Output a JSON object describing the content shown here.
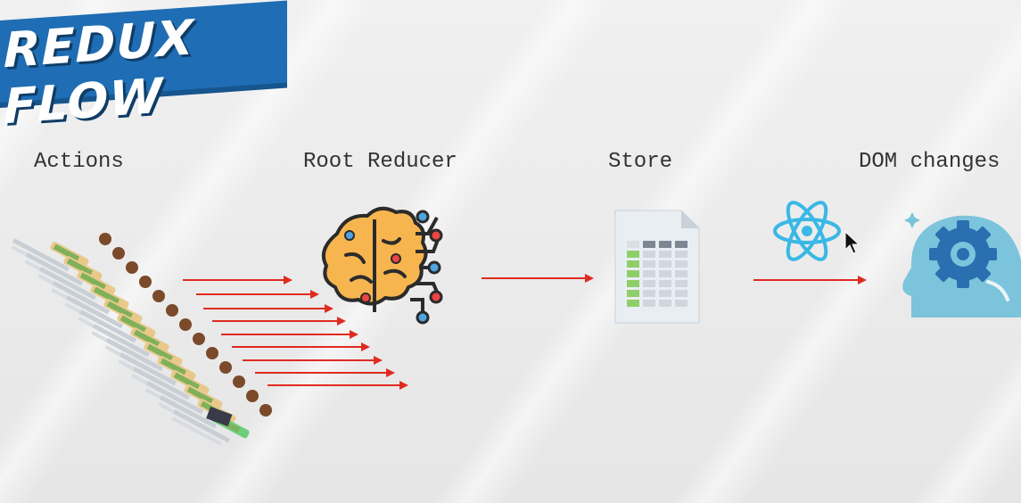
{
  "title": "REDUX FLOW",
  "stages": [
    {
      "label": "Actions"
    },
    {
      "label": "Root Reducer"
    },
    {
      "label": "Store"
    },
    {
      "label": "DOM changes"
    }
  ],
  "icons": {
    "actions": "crowd-running-icon",
    "reducer": "brain-circuit-icon",
    "store": "spreadsheet-document-icon",
    "react": "react-logo-icon",
    "dom": "head-gear-icon",
    "cursor": "mouse-cursor-icon"
  },
  "colors": {
    "banner": "#1f6db4",
    "arrow": "#e02b20",
    "react": "#39b8e6",
    "head": "#7cc3dc",
    "gear": "#2a6fb0"
  }
}
